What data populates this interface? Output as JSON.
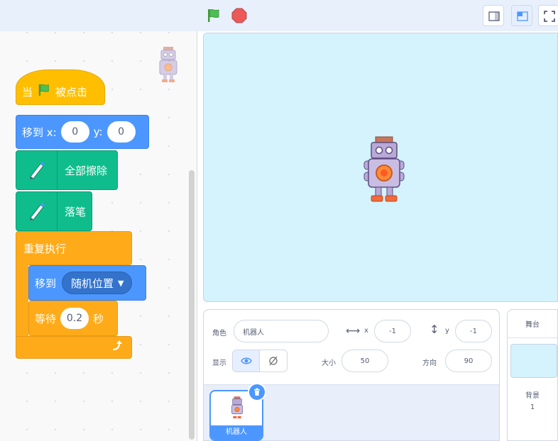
{
  "toolbar": {
    "green_flag_icon": "green-flag-icon",
    "stop_icon": "stop-icon",
    "small_stage_icon": "small-stage-icon",
    "normal_stage_icon": "normal-stage-icon",
    "fullscreen_icon": "fullscreen-icon"
  },
  "colors": {
    "events": "#ffbf00",
    "motion": "#4c97ff",
    "pen": "#0fbd8c",
    "control": "#ffab19",
    "stage_bg": "#d4f3fd"
  },
  "code": {
    "when_flag": {
      "prefix": "当",
      "suffix": "被点击"
    },
    "goto_xy": {
      "label": "移到 x:",
      "x": "0",
      "ylabel": "y:",
      "y": "0"
    },
    "erase_all": {
      "label": "全部擦除"
    },
    "pen_down": {
      "label": "落笔"
    },
    "forever": {
      "label": "重复执行"
    },
    "goto_random": {
      "label": "移到",
      "option": "随机位置"
    },
    "wait": {
      "label": "等待",
      "value": "0.2",
      "unit": "秒"
    }
  },
  "sprite_info": {
    "sprite_label": "角色",
    "sprite_name": "机器人",
    "x_label": "x",
    "x_value": "-1",
    "y_label": "y",
    "y_value": "-1",
    "show_label": "显示",
    "size_label": "大小",
    "size_value": "50",
    "direction_label": "方向",
    "direction_value": "90"
  },
  "sprite_list": [
    {
      "name": "机器人",
      "selected": true
    }
  ],
  "stage_pane": {
    "title": "舞台",
    "backdrop_label": "背景",
    "backdrop_count": "1"
  }
}
